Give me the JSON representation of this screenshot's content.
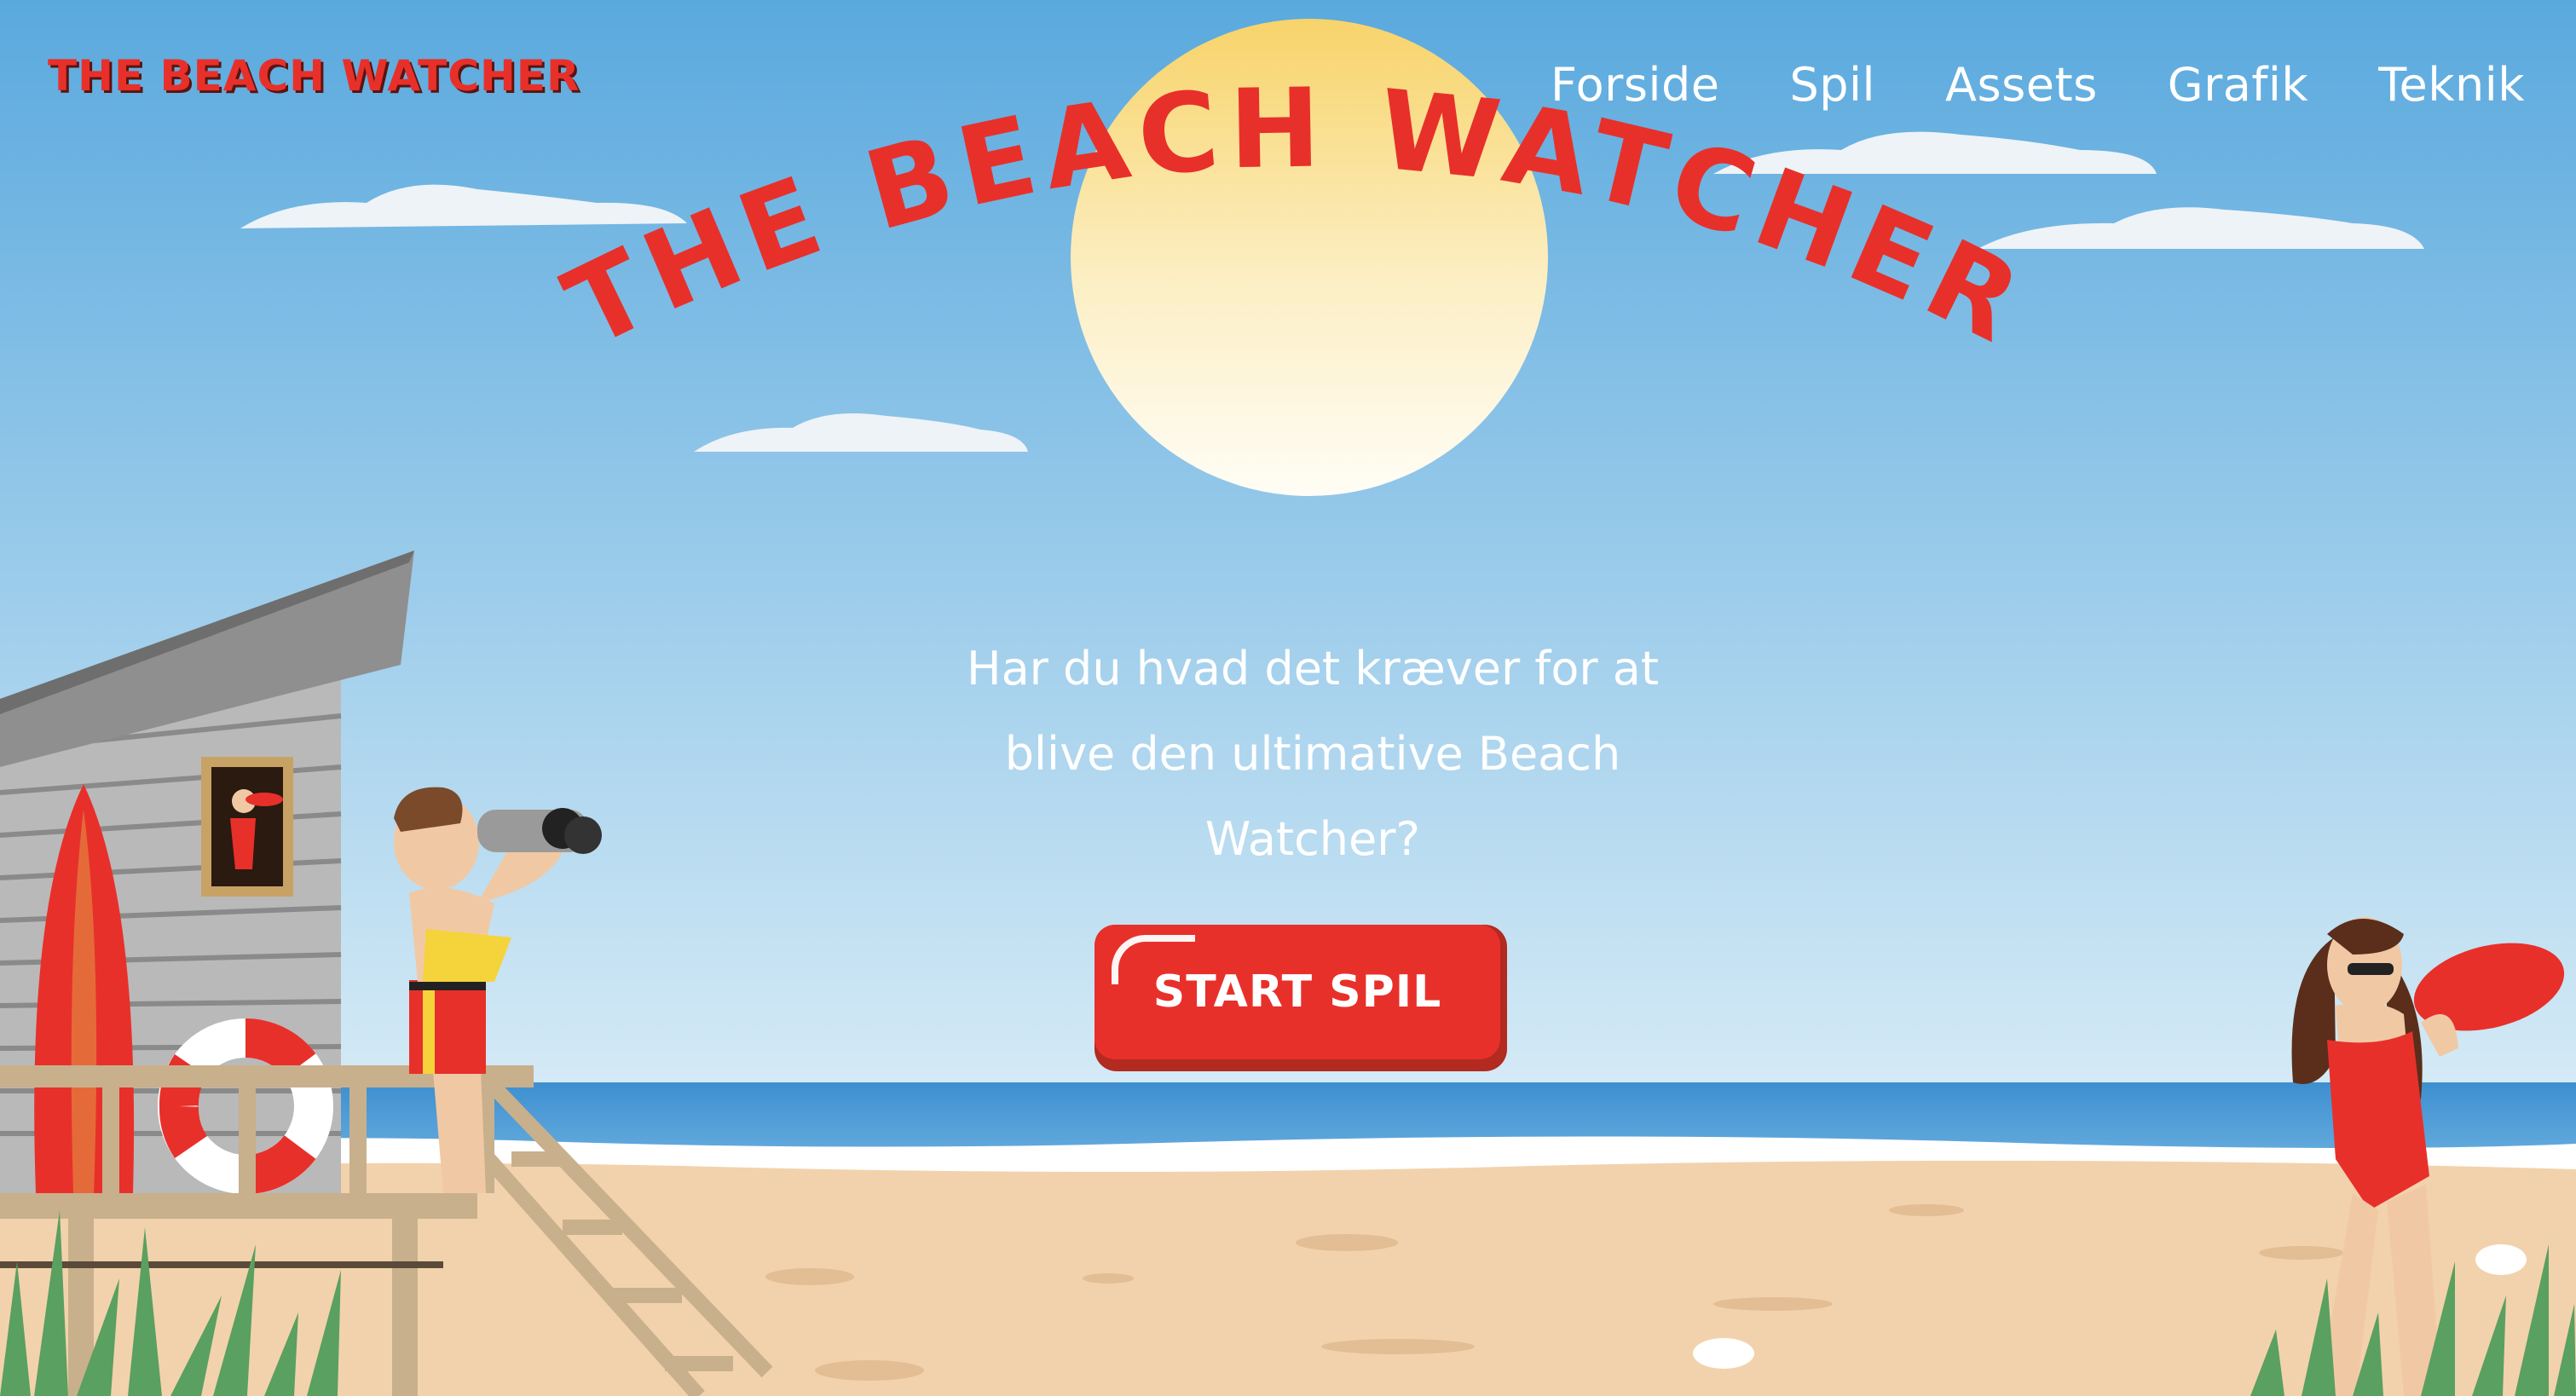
{
  "header": {
    "logo_text": "THE BEACH WATCHER",
    "nav": [
      "Forside",
      "Spil",
      "Assets",
      "Grafik",
      "Teknik"
    ]
  },
  "hero": {
    "title": "THE BEACH WATCHER",
    "tagline_lines": [
      "Har du hvad det kræver for at",
      "blive den ultimative Beach",
      "Watcher?"
    ],
    "start_button": "START SPIL"
  },
  "colors": {
    "sky_top": "#5aa9de",
    "sky_bottom": "#d6ebf6",
    "sun_top": "#f7d36a",
    "sun_bottom": "#fffdf6",
    "brand_red": "#e8302a",
    "sea": "#4d9bd6",
    "sand": "#f2d2ac"
  }
}
